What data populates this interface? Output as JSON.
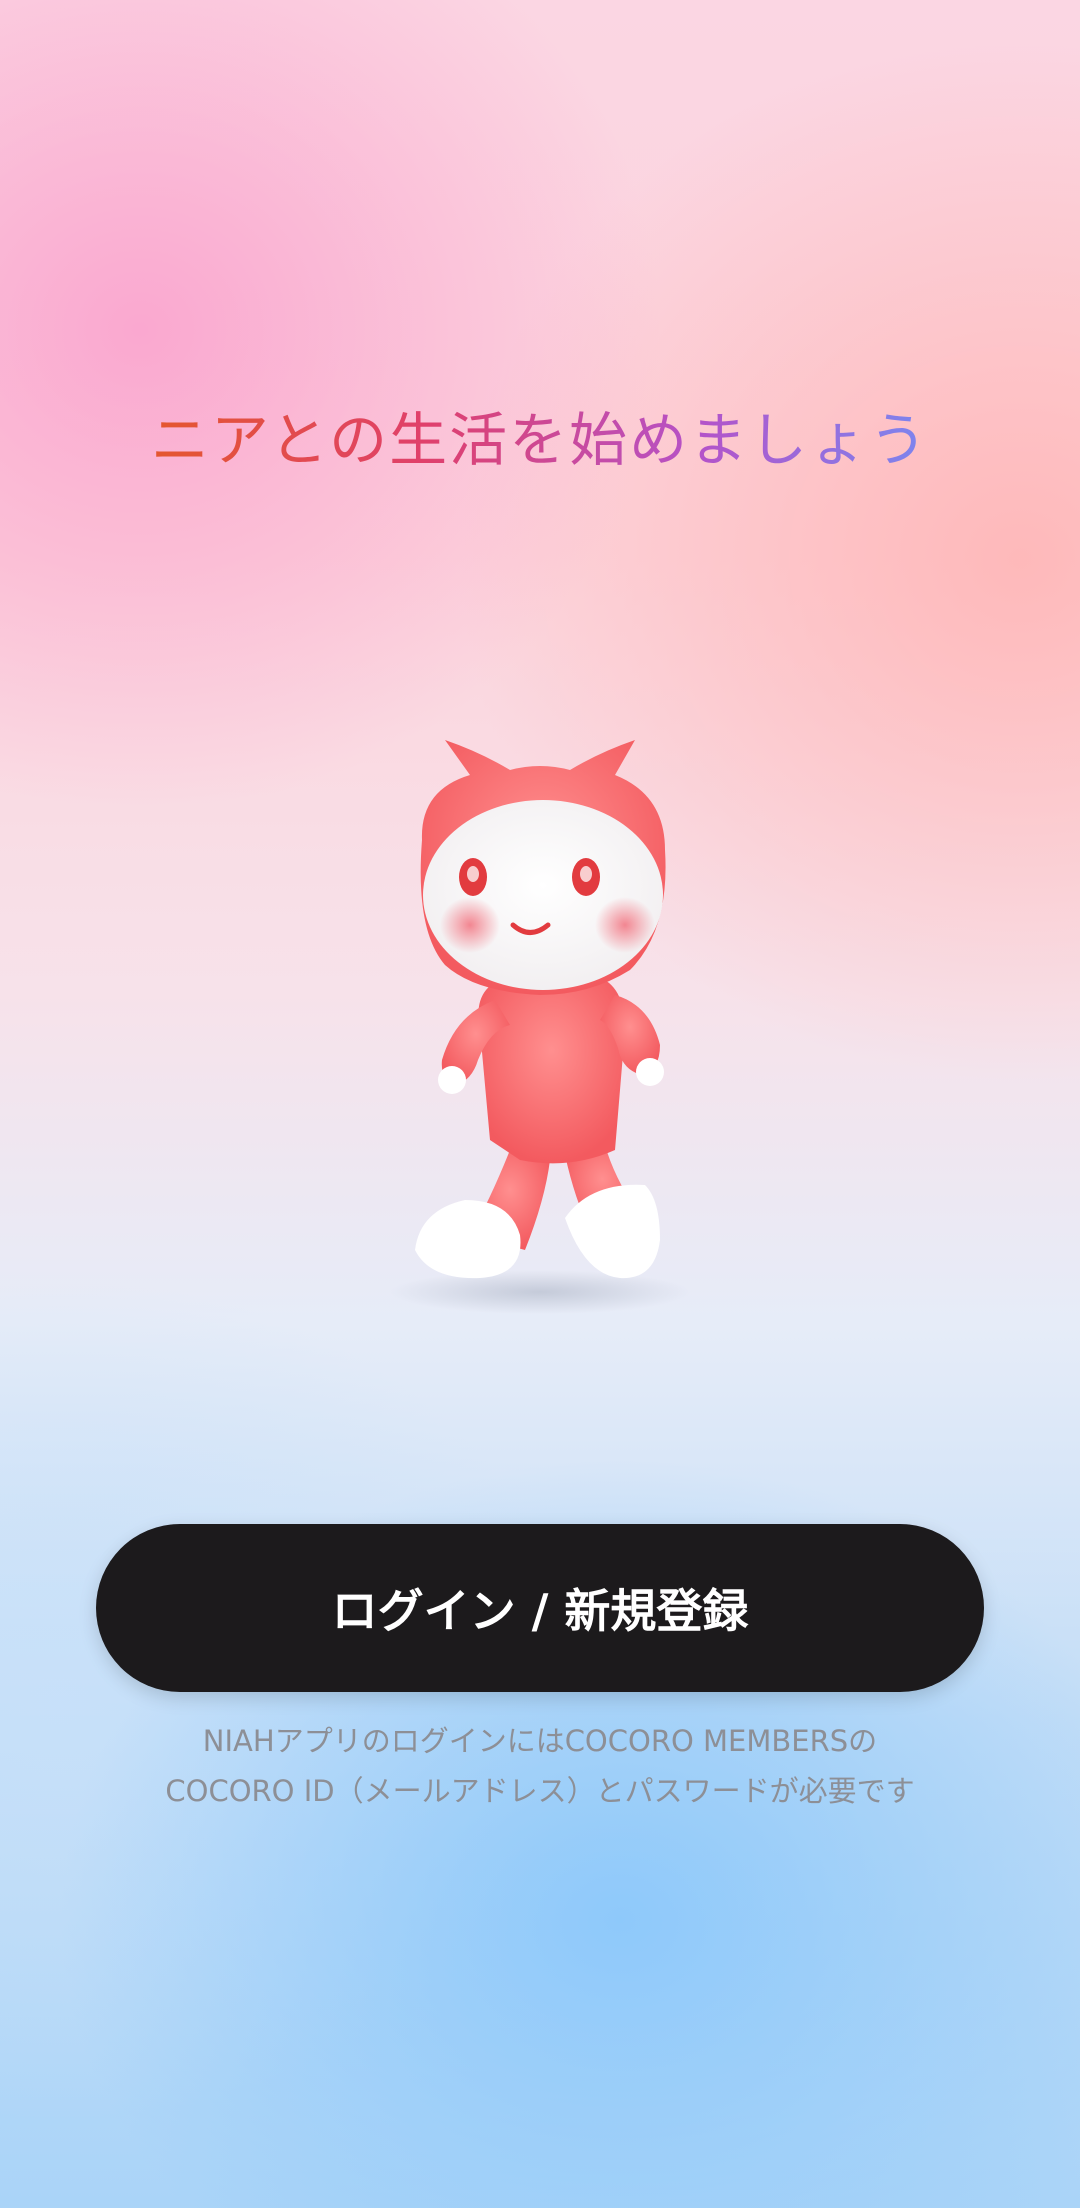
{
  "headline": "ニアとの生活を始めましょう",
  "login_button_label": "ログイン / 新規登録",
  "note": {
    "line1": "NIAHアプリのログインにはCOCORO MEMBERSの",
    "line2": "COCORO ID（メールアドレス）とパスワードが必要です"
  },
  "mascot_icon": "niah-mascot-character",
  "colors": {
    "button_bg": "#1c1a1c",
    "headline_start": "#e4572e",
    "headline_end": "#7b86ef",
    "note_text": "#8d8f96"
  }
}
